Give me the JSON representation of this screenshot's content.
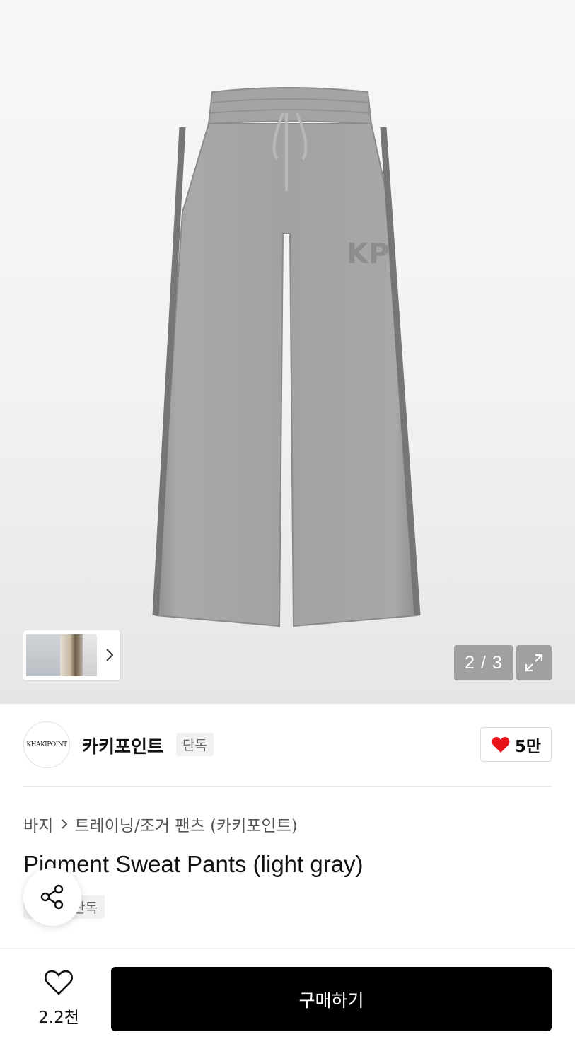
{
  "gallery": {
    "counter": "2 / 3",
    "icons": {
      "expand": "expand-arrows-icon",
      "thumb_next": "chevron-right-icon"
    }
  },
  "brand": {
    "logo_text": "KHAKIPOINT",
    "name": "카키포인트",
    "badge": "단독",
    "likes": "5만",
    "like_color": "#e8141c"
  },
  "breadcrumb": {
    "items": [
      "바지",
      "트레이닝/조거 팬츠 (카키포인트)"
    ]
  },
  "product": {
    "title": "Pigment Sweat Pants (light gray)",
    "exclusive_badge": "단독"
  },
  "bottom_bar": {
    "wish_count": "2.2천",
    "buy_label": "구매하기",
    "buy_color": "#000000"
  }
}
